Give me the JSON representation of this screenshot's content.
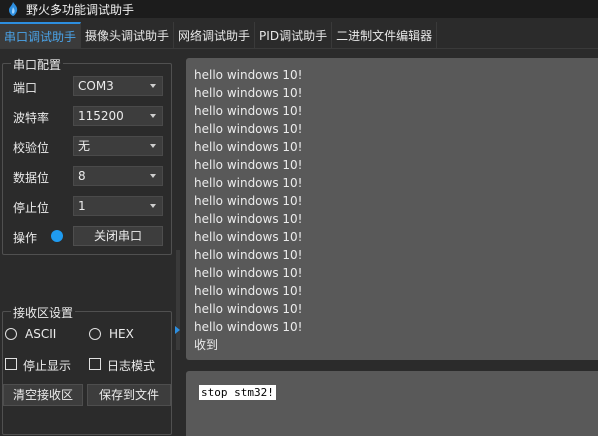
{
  "window": {
    "title": "野火多功能调试助手"
  },
  "tabs": [
    {
      "label": "串口调试助手"
    },
    {
      "label": "摄像头调试助手"
    },
    {
      "label": "网络调试助手"
    },
    {
      "label": "PID调试助手"
    },
    {
      "label": "二进制文件编辑器"
    }
  ],
  "serial_config": {
    "title": "串口配置",
    "port": {
      "label": "端口",
      "value": "COM3"
    },
    "baud": {
      "label": "波特率",
      "value": "115200"
    },
    "parity": {
      "label": "校验位",
      "value": "无"
    },
    "databits": {
      "label": "数据位",
      "value": "8"
    },
    "stopbits": {
      "label": "停止位",
      "value": "1"
    },
    "operation": {
      "label": "操作",
      "button": "关闭串口",
      "status_color": "#1f9bf0"
    }
  },
  "receive_settings": {
    "title": "接收区设置",
    "ascii_label": "ASCII",
    "hex_label": "HEX",
    "stop_display_label": "停止显示",
    "log_mode_label": "日志模式",
    "clear_button": "清空接收区",
    "save_button": "保存到文件"
  },
  "receive_area": {
    "lines": [
      "hello windows 10!",
      "hello windows 10!",
      "hello windows 10!",
      "hello windows 10!",
      "hello windows 10!",
      "hello windows 10!",
      "hello windows 10!",
      "hello windows 10!",
      "hello windows 10!",
      "hello windows 10!",
      "hello windows 10!",
      "hello windows 10!",
      "hello windows 10!",
      "hello windows 10!",
      "hello windows 10!",
      "收到"
    ]
  },
  "send_area": {
    "text": "stop stm32!"
  },
  "colors": {
    "accent": "#2d8fe0",
    "panel": "#595959",
    "background": "#2b2b2b"
  }
}
